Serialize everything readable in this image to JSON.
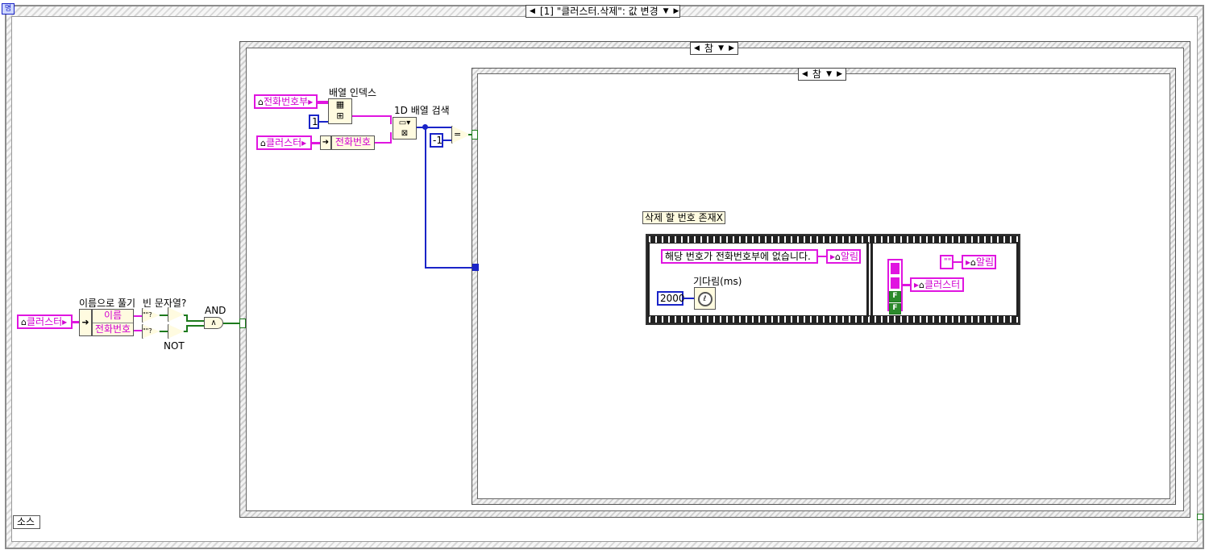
{
  "event_structure": {
    "selector": "[1] \"클러스터.삭제\": 값 변경",
    "source_terminal": "소스",
    "top_left_icon": "명"
  },
  "left_section": {
    "cluster_local": "클러스터",
    "unbundle_label": "이름으로 풀기",
    "unbundle_items": [
      "이름",
      "전화번호"
    ],
    "empty_string_label": "빈 문자열?",
    "empty_string_glyph": "\"\"?",
    "not_label": "NOT",
    "and_label": "AND"
  },
  "outer_case": {
    "selector": "참"
  },
  "array_section": {
    "phonebook_local": "전화번호부",
    "index_array_label": "배열 인덱스",
    "index_constant": "1",
    "cluster_local": "클러스터",
    "unbundle_item": "전화번호",
    "search_label": "1D 배열 검색",
    "neg_one_constant": "-1",
    "equal_glyph": "="
  },
  "inner_case": {
    "selector": "참"
  },
  "sequence": {
    "label": "삭제 할 번호 존재X",
    "frame1": {
      "message_string": "해당 번호가 전화번호부에 없습니다.",
      "alarm_local": "알림",
      "wait_label": "기다림(ms)",
      "wait_constant": "2000"
    },
    "frame2": {
      "empty_string": "\"\"",
      "alarm_local": "알림",
      "cluster_local": "클러스터",
      "bool_false_1": "F",
      "bool_false_2": "F"
    }
  }
}
